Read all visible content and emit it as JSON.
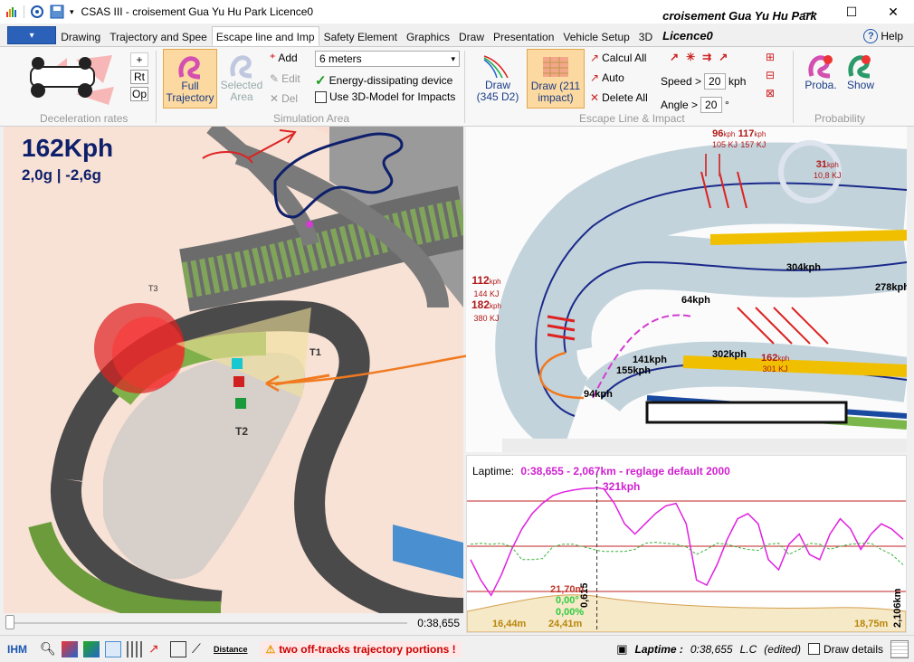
{
  "window": {
    "title": "CSAS III - croisement Gua Yu Hu Park Licence0"
  },
  "tabs": [
    "Drawing",
    "Trajectory and Spee",
    "Escape line and Imp",
    "Safety Element",
    "Graphics",
    "Draw",
    "Presentation",
    "Vehicle Setup",
    "3D"
  ],
  "ribbon_title": "croisement Gua Yu Hu Park Licence0",
  "help_label": "Help",
  "ribbon": {
    "deceleration": {
      "plus_label": "+",
      "rt_label": "Rt",
      "op_label": "Op",
      "group_label": "Deceleration rates"
    },
    "simulation": {
      "full_trajectory_label": "Full\nTrajectory",
      "full_line1": "Full",
      "full_line2": "Trajectory",
      "selected_line1": "Selected",
      "selected_line2": "Area",
      "add_label": "Add",
      "edit_label": "Edit",
      "del_label": "Del",
      "distance_value": "6 meters",
      "energy_label": "Energy-dissipating device",
      "model3d_label": "Use 3D-Model for Impacts",
      "group_label": "Simulation Area"
    },
    "escape": {
      "draw1_line1": "Draw",
      "draw1_line2": "(345 D2)",
      "draw2_line1": "Draw  (211",
      "draw2_line2": "impact)",
      "calcul_label": "Calcul All",
      "auto_label": "Auto",
      "delete_label": "Delete All",
      "speed_label": "Speed >",
      "speed_value": "20",
      "speed_unit": "kph",
      "angle_label": "Angle >",
      "angle_value": "20",
      "angle_unit": "°",
      "group_label": "Escape Line & Impact"
    },
    "probability": {
      "proba_label": "Proba.",
      "show_label": "Show",
      "group_label": "Probability"
    }
  },
  "view3d": {
    "speed": "162Kph",
    "gforce": "2,0g | -2,6g",
    "labels": [
      "T3",
      "T1",
      "T2"
    ]
  },
  "map2d": {
    "annotations": [
      {
        "speed": "96",
        "speed2": "117",
        "unit": "kph",
        "kj1": "105 KJ",
        "kj2": "157 KJ"
      },
      {
        "speed": "31",
        "unit": "kph",
        "kj": "10,8 KJ"
      },
      {
        "speed": "112",
        "unit": "kph",
        "kj": "144 KJ"
      },
      {
        "speed": "182",
        "unit": "kph",
        "kj": "380 KJ"
      },
      {
        "speed": "162",
        "unit": "kph",
        "kj": "301 KJ"
      }
    ],
    "speeds": [
      "304kph",
      "278kph",
      "64kph",
      "302kph",
      "141kph",
      "155kph",
      "94kph"
    ]
  },
  "chart_data": {
    "type": "line",
    "title": "Laptime:  0:38,655 - 2,067km - reglage default 2000",
    "title_label": "Laptime:",
    "title_value": "0:38,655 - 2,067km - reglage default 2000",
    "peak_label": "321kph",
    "cursor_label": "0,615",
    "elevation_labels": {
      "top": "21,70m",
      "slope": "0,00°",
      "grade": "0,00%",
      "left": "16,44m",
      "mid": "24,41m",
      "right": "18,75m",
      "dist": "2,106km"
    },
    "x": [
      0,
      0.05,
      0.1,
      0.15,
      0.2,
      0.25,
      0.3,
      0.35,
      0.4,
      0.45,
      0.5,
      0.55,
      0.6,
      0.615,
      0.65,
      0.7,
      0.75,
      0.8,
      0.85,
      0.9,
      0.95,
      1.0,
      1.05,
      1.1,
      1.15,
      1.2,
      1.25,
      1.3,
      1.35,
      1.4,
      1.45,
      1.5,
      1.55,
      1.6,
      1.65,
      1.7,
      1.75,
      1.8,
      1.85,
      1.9,
      1.95,
      2.0,
      2.05,
      2.106
    ],
    "series": [
      {
        "name": "speed",
        "color": "#e020e0",
        "values": [
          180,
          140,
          110,
          150,
          200,
          240,
          270,
          290,
          305,
          312,
          316,
          319,
          320,
          321,
          318,
          290,
          250,
          230,
          250,
          270,
          285,
          290,
          250,
          140,
          130,
          170,
          220,
          260,
          270,
          250,
          180,
          160,
          210,
          230,
          190,
          180,
          230,
          260,
          240,
          200,
          230,
          250,
          240,
          220
        ]
      },
      {
        "name": "g",
        "color": "#3cb43c",
        "values": [
          210,
          212,
          210,
          212,
          205,
          180,
          180,
          182,
          205,
          210,
          210,
          205,
          200,
          198,
          196,
          196,
          196,
          200,
          212,
          214,
          212,
          210,
          205,
          190,
          200,
          212,
          210,
          204,
          200,
          198,
          210,
          212,
          190,
          200,
          212,
          210,
          200,
          206,
          210,
          212,
          212,
          200,
          190,
          170
        ]
      }
    ]
  },
  "slider": {
    "time": "0:38,655"
  },
  "status": {
    "ihm": "IHM",
    "distance": "Distance",
    "warning": "two off-tracks trajectory portions !",
    "laptime_label": "Laptime :",
    "laptime_value": "0:38,655",
    "lc": "L.C",
    "edited": "(edited)",
    "draw_details": "Draw details"
  }
}
